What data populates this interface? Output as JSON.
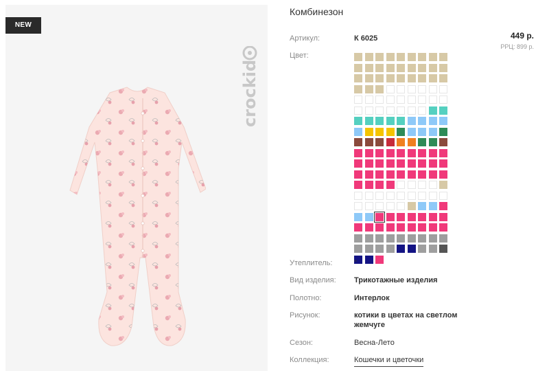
{
  "product": {
    "badge": "NEW",
    "brand": "crockid",
    "title": "Комбинезон",
    "price": "449 р.",
    "rrp": "РРЦ: 899 р."
  },
  "specs": {
    "article_label": "Артикул:",
    "article_value": "К 6025",
    "color_label": "Цвет:",
    "insulation_label": "Утеплитель:",
    "insulation_value": "\"",
    "type_label": "Вид изделия:",
    "type_value": "Трикотажные изделия",
    "fabric_label": "Полотно:",
    "fabric_value": "Интерлок",
    "pattern_label": "Рисунок:",
    "pattern_value_line1": "котики в цветах на светлом",
    "pattern_value_line2": "жемчуге",
    "season_label": "Сезон:",
    "season_value": "Весна-Лето",
    "collection_label": "Коллекция:",
    "collection_value": "Кошечки и цветочки"
  },
  "swatches": {
    "colors": {
      "b": "#d7c9a6",
      "e": "#ffffff",
      "t": "#55d0c0",
      "l": "#8ec9f8",
      "y": "#f5c400",
      "g": "#2e8b57",
      "r": "#8b4a3c",
      "d": "#c72b3b",
      "o": "#f08020",
      "p": "#f0397a",
      "s": "#9e9e9e",
      "n": "#141484",
      "k": "#555555"
    },
    "rows": [
      "bbbbbbbbb",
      "bbbbbbbbb",
      "bbbbbbbbb",
      "bbbeeeeee",
      "eeeeeeeee",
      "eeeeeeett",
      "tttttllll",
      "lyyyglllg",
      "rrrdoogg r",
      "ppppppppp",
      "ppppppppp",
      "ppppppppp",
      "ppppeeeeb",
      "eeeeeeeee",
      "eeeeebllp",
      "llpppppp p",
      "ppppppppp",
      "sssssssss",
      "ssssnnssk",
      "nnp"
    ],
    "selected_row": 15,
    "selected_col": 2
  }
}
